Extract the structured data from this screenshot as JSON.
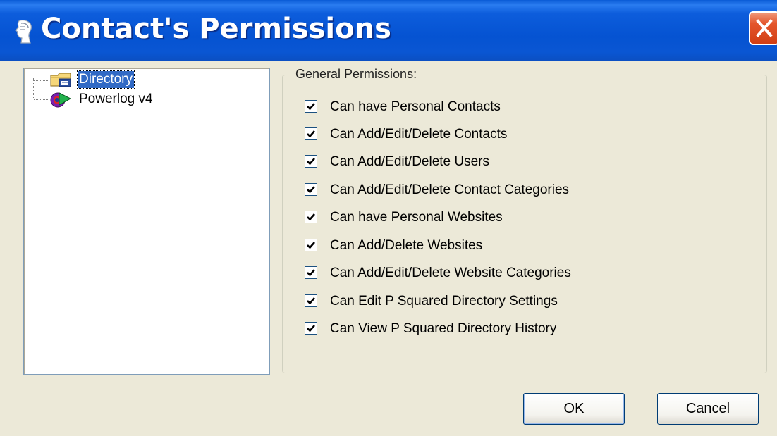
{
  "window": {
    "title": "Contact's Permissions"
  },
  "tree": {
    "items": [
      {
        "label": "Directory",
        "icon": "folder-icon",
        "selected": true
      },
      {
        "label": "Powerlog v4",
        "icon": "powerlog-app-icon",
        "selected": false
      }
    ]
  },
  "general_permissions": {
    "title": "General Permissions:",
    "items": [
      {
        "label": "Can have Personal Contacts",
        "checked": true
      },
      {
        "label": "Can Add/Edit/Delete Contacts",
        "checked": true
      },
      {
        "label": "Can Add/Edit/Delete Users",
        "checked": true
      },
      {
        "label": "Can Add/Edit/Delete Contact Categories",
        "checked": true
      },
      {
        "label": "Can have Personal Websites",
        "checked": true
      },
      {
        "label": "Can Add/Delete Websites",
        "checked": true
      },
      {
        "label": "Can Add/Edit/Delete Website Categories",
        "checked": true
      },
      {
        "label": "Can Edit P Squared Directory Settings",
        "checked": true
      },
      {
        "label": "Can View P Squared Directory History",
        "checked": true
      }
    ]
  },
  "buttons": {
    "ok_label": "OK",
    "cancel_label": "Cancel"
  },
  "colors": {
    "titlebar": "#0553d2",
    "selection": "#316ac5",
    "close_button": "#e4562c",
    "dialog_background": "#ece9d8"
  }
}
